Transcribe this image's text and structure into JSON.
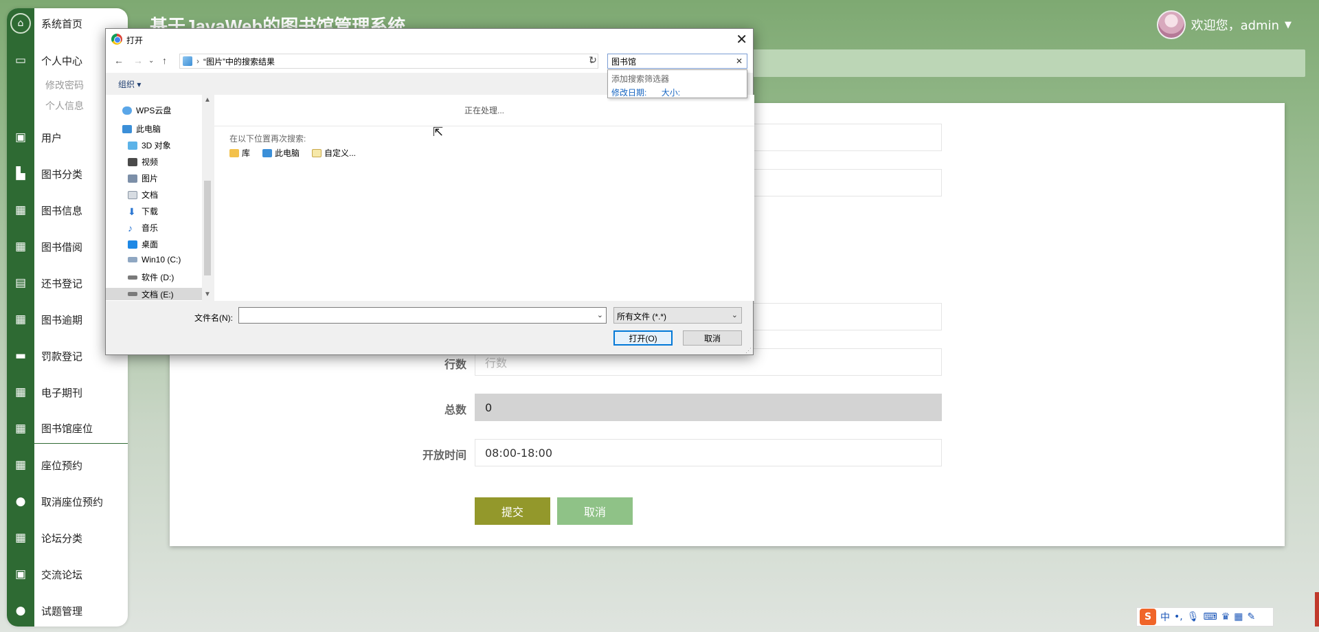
{
  "app": {
    "title": "基于JavaWeb的图书馆管理系统",
    "welcome": "欢迎您，admin"
  },
  "sidebar": {
    "items": [
      {
        "label": "系统首页",
        "icon": "home-icon"
      },
      {
        "label": "个人中心",
        "icon": "card-icon"
      },
      {
        "label": "用户",
        "icon": "briefcase-icon"
      },
      {
        "label": "图书分类",
        "icon": "cart-icon"
      },
      {
        "label": "图书信息",
        "icon": "grid-icon"
      },
      {
        "label": "图书借阅",
        "icon": "grid-icon"
      },
      {
        "label": "还书登记",
        "icon": "clipboard-icon"
      },
      {
        "label": "图书逾期",
        "icon": "grid9-icon"
      },
      {
        "label": "罚款登记",
        "icon": "printer-icon"
      },
      {
        "label": "电子期刊",
        "icon": "grid-icon"
      },
      {
        "label": "图书馆座位",
        "icon": "grid-icon"
      },
      {
        "label": "座位预约",
        "icon": "grid-icon"
      },
      {
        "label": "取消座位预约",
        "icon": "bulb-icon"
      },
      {
        "label": "论坛分类",
        "icon": "grid-icon"
      },
      {
        "label": "交流论坛",
        "icon": "clipboard-x-icon"
      },
      {
        "label": "试题管理",
        "icon": "user-icon"
      }
    ],
    "sub_items": [
      "修改密码",
      "个人信息"
    ]
  },
  "form": {
    "rows_label": "行数",
    "rows_placeholder": "行数",
    "total_label": "总数",
    "total_value": "0",
    "open_time_label": "开放时间",
    "open_time_value": "08:00-18:00",
    "submit_label": "提交",
    "cancel_label": "取消"
  },
  "dialog": {
    "title": "打开",
    "close": "✕",
    "address": "“图片”中的搜索结果",
    "search_value": "图书馆",
    "search_filter_head": "添加搜索筛选器",
    "filter_date": "修改日期:",
    "filter_size": "大小:",
    "organize": "组织 ▾",
    "processing": "正在处理...",
    "search_again": "在以下位置再次搜索:",
    "locations": [
      "库",
      "此电脑",
      "自定义..."
    ],
    "tree": [
      "WPS云盘",
      "此电脑",
      "3D 对象",
      "视频",
      "图片",
      "文档",
      "下载",
      "音乐",
      "桌面",
      "Win10 (C:)",
      "软件 (D:)",
      "文档 (E:)"
    ],
    "filename_label": "文件名(N):",
    "filename_value": "",
    "filetype": "所有文件 (*.*)",
    "open_button": "打开(O)",
    "cancel_button": "取消"
  },
  "ime": {
    "mode": "中"
  },
  "colors": {
    "sidebar_strip": "#2e6a33",
    "submit": "#93982b",
    "cancel": "#8fc287",
    "accent_link": "#1665c1"
  }
}
